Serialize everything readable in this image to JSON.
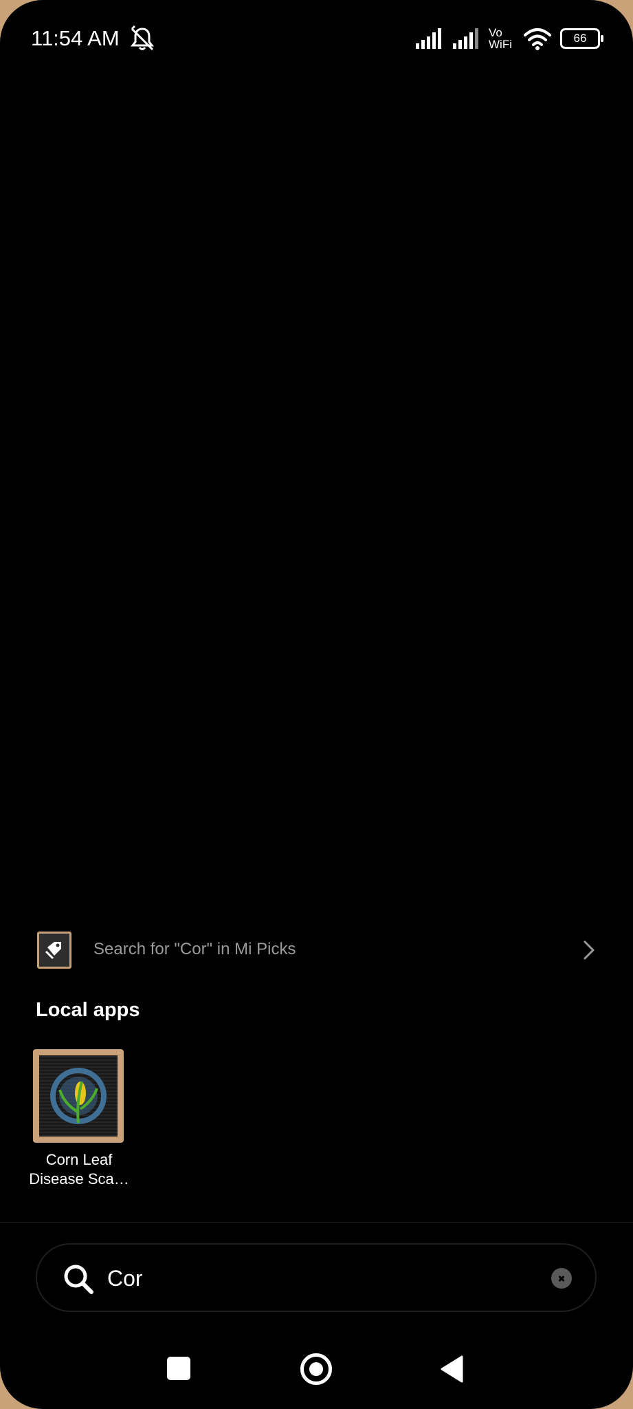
{
  "status_bar": {
    "time": "11:54 AM",
    "vowifi_top": "Vo",
    "vowifi_bottom": "WiFi",
    "battery": "66",
    "icons": [
      "bell-off-icon",
      "signal-icon",
      "signal-icon",
      "wifi-icon",
      "battery-icon"
    ]
  },
  "mi_picks": {
    "label": "Search for \"Cor\" in Mi Picks",
    "icon": "mi-picks-icon"
  },
  "local_apps": {
    "title": "Local apps",
    "apps": [
      {
        "label_line1": "Corn Leaf",
        "label_line2": "Disease Sca…"
      }
    ]
  },
  "search": {
    "value": "Cor"
  },
  "nav": {
    "icons": [
      "recents-icon",
      "home-icon",
      "back-icon"
    ]
  },
  "colors": {
    "background": "#000000",
    "wallpaper_edge": "#c9a27a",
    "muted_text": "#9a9a9a"
  }
}
